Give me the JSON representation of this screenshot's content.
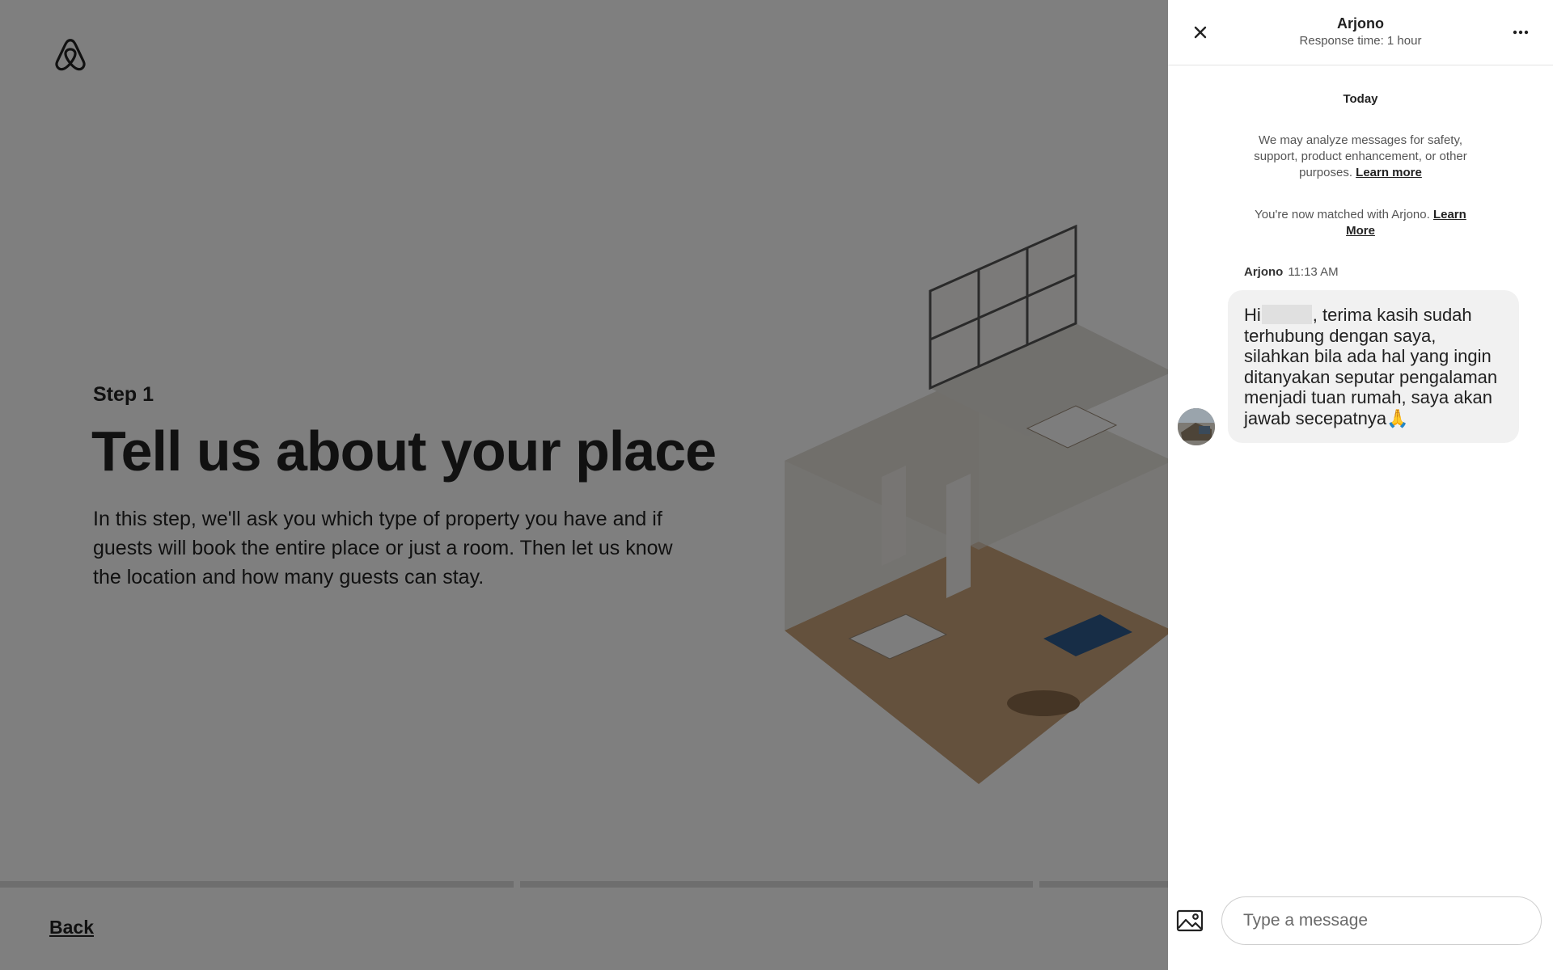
{
  "page": {
    "step_label": "Step 1",
    "heading": "Tell us about your place",
    "description": "In this step, we'll ask you which type of property you have and if guests will book the entire place or just a room. Then let us know the location and how many guests can stay.",
    "back_label": "Back",
    "logo_icon": "airbnb-logo-icon"
  },
  "chat": {
    "host_name": "Arjono",
    "response_time": "Response time: 1 hour",
    "close_icon": "close-icon",
    "more_icon": "more-options-icon",
    "date_separator": "Today",
    "notice_safety": {
      "text": "We may analyze messages for safety, support, product enhancement, or other purposes.",
      "link": "Learn more"
    },
    "notice_match": {
      "text": "You're now matched with Arjono.",
      "link": "Learn More"
    },
    "message": {
      "sender": "Arjono",
      "time": "11:13 AM",
      "greeting": "Hi",
      "body": ", terima kasih sudah terhubung dengan saya, silahkan bila ada hal yang ingin ditanyakan seputar pengalaman menjadi tuan rumah, saya akan jawab secepatnya🙏"
    },
    "photo_icon": "image-icon",
    "input_placeholder": "Type a message"
  },
  "colors": {
    "overlay": "rgba(0,0,0,0.5)",
    "bubble": "#f1f1f1",
    "text": "#222222"
  }
}
